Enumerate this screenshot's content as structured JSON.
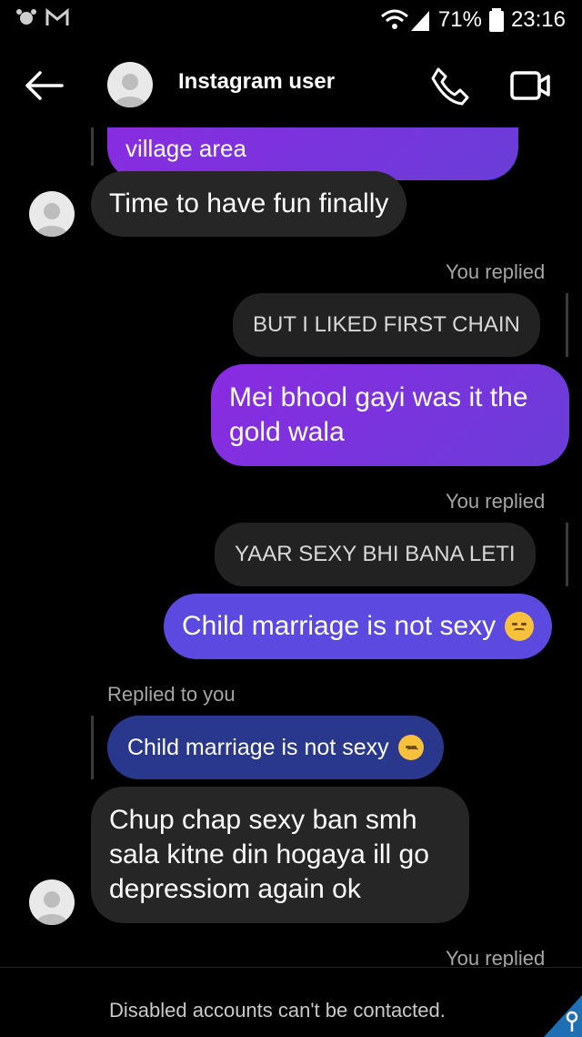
{
  "status_bar": {
    "battery_percent": "71%",
    "time": "23:16"
  },
  "header": {
    "contact_name": "Instagram user"
  },
  "messages": {
    "m0_partial_text": "village area",
    "m1_text": "Time to have fun finally",
    "replied_label": "You replied",
    "replied_label_2": "You replied",
    "quote_1": "BUT I LIKED FIRST CHAIN",
    "m2_line1": "Mei bhool gayi was it the",
    "m2_line2": "gold wala",
    "quote_2": "YAAR SEXY BHI BANA LETI",
    "m3_text": "Child marriage is not sexy",
    "replied_to_you": "Replied to you",
    "m4_quote": "Child marriage is not sexy",
    "m5_line1": "Chup chap sexy ban smh",
    "m5_line2": "sala kitne din hogaya ill go",
    "m5_line3": "depressiom again ok",
    "bottom_replied": "You replied"
  },
  "footer": {
    "notice": "Disabled accounts can't be contacted."
  },
  "colors": {
    "purple_bubble": "#7a36dc",
    "indigo_bubble": "#5b49e0",
    "navy_bubble": "#29388c",
    "grey_bubble": "#262626"
  }
}
